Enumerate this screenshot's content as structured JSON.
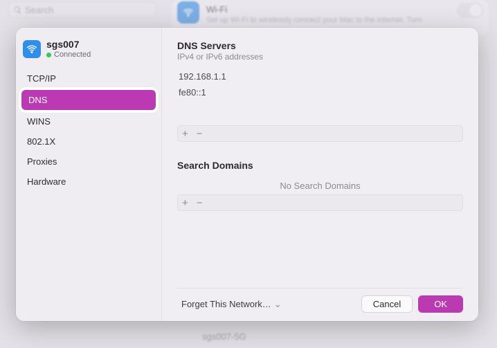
{
  "background": {
    "search_placeholder": "Search",
    "wifi_title": "Wi-Fi",
    "wifi_subtitle": "Set up Wi-Fi to wirelessly connect your Mac to the internet. Turn",
    "bottom_ssid": "sgs007-5G"
  },
  "network": {
    "ssid": "sgs007",
    "status_label": "Connected"
  },
  "tabs": [
    {
      "key": "tcpip",
      "label": "TCP/IP",
      "selected": false
    },
    {
      "key": "dns",
      "label": "DNS",
      "selected": true
    },
    {
      "key": "wins",
      "label": "WINS",
      "selected": false
    },
    {
      "key": "8021x",
      "label": "802.1X",
      "selected": false
    },
    {
      "key": "proxies",
      "label": "Proxies",
      "selected": false
    },
    {
      "key": "hardware",
      "label": "Hardware",
      "selected": false
    }
  ],
  "dns": {
    "title": "DNS Servers",
    "subtitle": "IPv4 or IPv6 addresses",
    "servers": [
      "192.168.1.1",
      "fe80::1"
    ],
    "add_glyph": "+",
    "remove_glyph": "−"
  },
  "search_domains": {
    "title": "Search Domains",
    "empty_text": "No Search Domains",
    "add_glyph": "+",
    "remove_glyph": "−"
  },
  "footer": {
    "forget_label": "Forget This Network…",
    "cancel_label": "Cancel",
    "ok_label": "OK"
  },
  "colors": {
    "accent": "#ba3ab2",
    "wifi_icon_bg": "#2f8eea",
    "connected_dot": "#34c759"
  }
}
